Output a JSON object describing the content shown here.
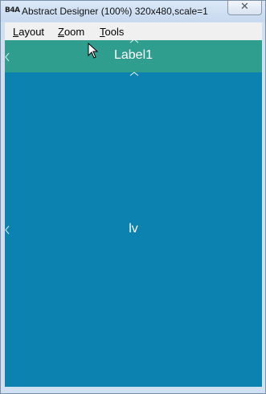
{
  "window": {
    "app_icon_text": "B4A",
    "title": "Abstract Designer (100%) 320x480,scale=1",
    "close_glyph": "✕"
  },
  "menu": {
    "items": [
      {
        "accel": "L",
        "rest": "ayout"
      },
      {
        "accel": "Z",
        "rest": "oom"
      },
      {
        "accel": "T",
        "rest": "ools"
      }
    ]
  },
  "designer": {
    "label1_text": "Label1",
    "listview_text": "lv",
    "colors": {
      "label1_bg": "#2f9e8f",
      "listview_bg": "#0b82b0"
    }
  },
  "icons": {
    "handle_left": "chevron-left-icon",
    "handle_up": "chevron-up-icon",
    "cursor": "mouse-pointer-icon"
  }
}
